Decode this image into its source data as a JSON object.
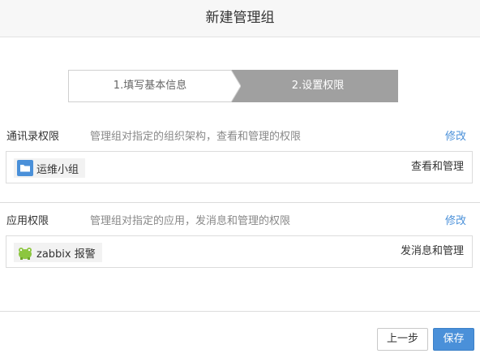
{
  "dialog": {
    "title": "新建管理组"
  },
  "steps": [
    {
      "label": "1.填写基本信息"
    },
    {
      "label": "2.设置权限"
    }
  ],
  "contacts": {
    "title": "通讯录权限",
    "desc": "管理组对指定的组织架构，查看和管理的权限",
    "edit": "修改",
    "item": {
      "name": "运维小组",
      "icon": "folder-icon"
    },
    "permission": "查看和管理"
  },
  "apps": {
    "title": "应用权限",
    "desc": "管理组对指定的应用，发消息和管理的权限",
    "edit": "修改",
    "item": {
      "name": "zabbix 报警",
      "icon": "android-app-icon"
    },
    "permission": "发消息和管理"
  },
  "footer": {
    "prev": "上一步",
    "save": "保存"
  },
  "colors": {
    "accent": "#4a90d9",
    "step_active": "#a0a0a0"
  }
}
